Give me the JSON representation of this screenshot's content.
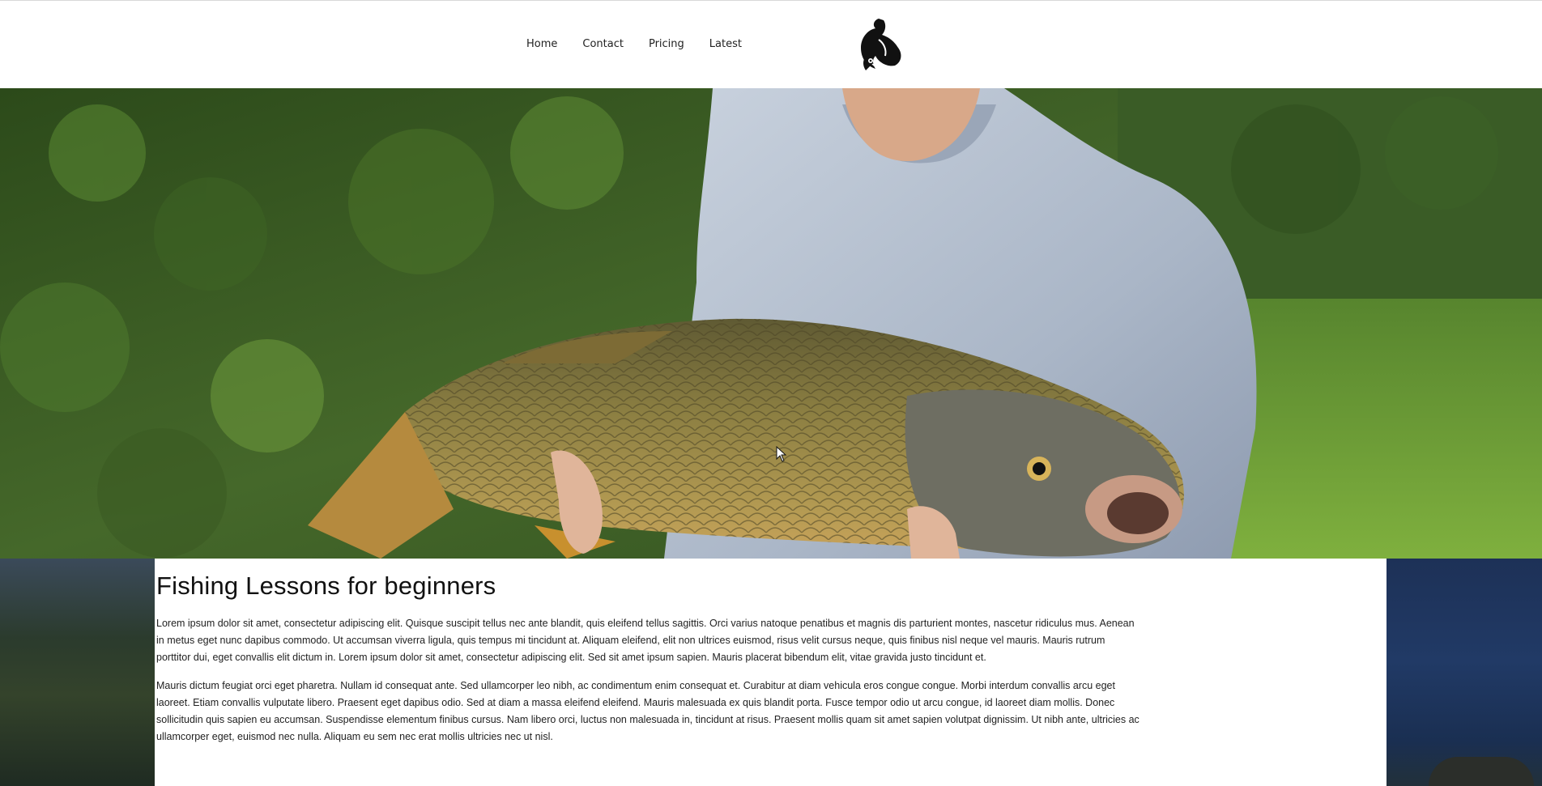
{
  "nav": {
    "items": [
      {
        "label": "Home"
      },
      {
        "label": "Contact"
      },
      {
        "label": "Pricing"
      },
      {
        "label": "Latest"
      }
    ]
  },
  "hero": {
    "image": "man-holding-carp-photo"
  },
  "main": {
    "title": "Fishing Lessons for beginners",
    "paragraphs": [
      "Lorem ipsum dolor sit amet, consectetur adipiscing elit. Quisque suscipit tellus nec ante blandit, quis eleifend tellus sagittis. Orci varius natoque penatibus et magnis dis parturient montes, nascetur ridiculus mus. Aenean in metus eget nunc dapibus commodo. Ut accumsan viverra ligula, quis tempus mi tincidunt at. Aliquam eleifend, elit non ultrices euismod, risus velit cursus neque, quis finibus nisl neque vel mauris. Mauris rutrum porttitor dui, eget convallis elit dictum in. Lorem ipsum dolor sit amet, consectetur adipiscing elit. Sed sit amet ipsum sapien. Mauris placerat bibendum elit, vitae gravida justo tincidunt et.",
      "Mauris dictum feugiat orci eget pharetra. Nullam id consequat ante. Sed ullamcorper leo nibh, ac condimentum enim consequat et. Curabitur at diam vehicula eros congue congue. Morbi interdum convallis arcu eget laoreet. Etiam convallis vulputate libero. Praesent eget dapibus odio. Sed at diam a massa eleifend eleifend. Mauris malesuada ex quis blandit porta. Fusce tempor odio ut arcu congue, id laoreet diam mollis. Donec sollicitudin quis sapien eu accumsan. Suspendisse elementum finibus cursus. Nam libero orci, luctus non malesuada in, tincidunt at risus. Praesent mollis quam sit amet sapien volutpat dignissim. Ut nibh ante, ultricies ac ullamcorper eget, euismod nec nulla. Aliquam eu sem nec erat mollis ultricies nec ut nisl."
    ]
  },
  "colors": {
    "header_bg": "#ffffff",
    "text": "#222222",
    "foliage": "#4a6b2a",
    "sweater": "#b8c4d4",
    "carp": "#8a7a3e"
  }
}
